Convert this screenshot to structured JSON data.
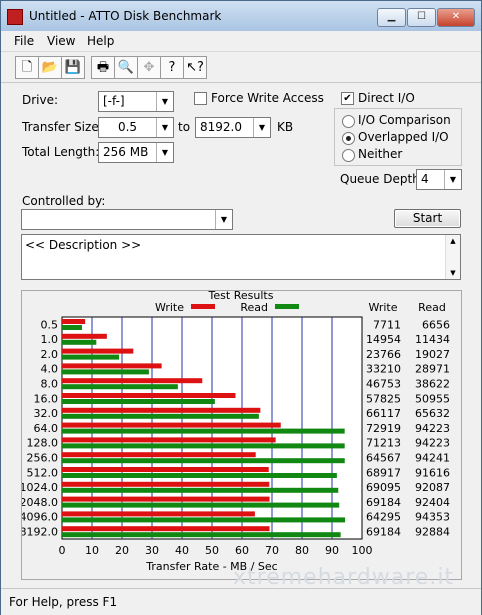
{
  "window": {
    "title": "Untitled - ATTO Disk Benchmark"
  },
  "title_buttons": {
    "minimize": "▁",
    "maximize": "☐",
    "close": "✕"
  },
  "menu": [
    "File",
    "View",
    "Help"
  ],
  "toolbar": [
    "new-icon",
    "open-icon",
    "save-icon",
    "print-icon",
    "print-preview-icon",
    "move-icon",
    "help-icon",
    "context-help-icon"
  ],
  "settings": {
    "drive_label": "Drive:",
    "drive_value": "[-f-]",
    "force_write_label": "Force Write Access",
    "force_write_checked": false,
    "direct_io_label": "Direct I/O",
    "direct_io_checked": true,
    "transfer_size_label": "Transfer Size:",
    "transfer_from": "0.5",
    "transfer_to_label": "to",
    "transfer_to": "8192.0",
    "transfer_unit": "KB",
    "total_length_label": "Total Length:",
    "total_length": "256 MB",
    "io_options": [
      "I/O Comparison",
      "Overlapped I/O",
      "Neither"
    ],
    "io_selected": "Overlapped I/O",
    "queue_depth_label": "Queue Depth:",
    "queue_depth": "4",
    "controlled_by_label": "Controlled by:",
    "controlled_by_value": "",
    "start_label": "Start",
    "description": "<< Description >>"
  },
  "results": {
    "title": "Test Results",
    "legend_write": "Write",
    "legend_read": "Read",
    "col_write": "Write",
    "col_read": "Read",
    "write_color": "#dd1111",
    "read_color": "#118811"
  },
  "chart_data": {
    "type": "bar",
    "xlabel": "Transfer Rate - MB / Sec",
    "xlim": [
      0,
      100
    ],
    "xticks": [
      "0",
      "10",
      "20",
      "30",
      "40",
      "50",
      "60",
      "70",
      "80",
      "90",
      "100"
    ],
    "categories": [
      "0.5",
      "1.0",
      "2.0",
      "4.0",
      "8.0",
      "16.0",
      "32.0",
      "64.0",
      "128.0",
      "256.0",
      "512.0",
      "1024.0",
      "2048.0",
      "4096.0",
      "8192.0"
    ],
    "series": [
      {
        "name": "Write",
        "values": [
          7.711,
          14.954,
          23.766,
          33.21,
          46.753,
          57.825,
          66.117,
          72.919,
          71.213,
          64.567,
          68.917,
          69.095,
          69.184,
          64.295,
          69.184
        ]
      },
      {
        "name": "Read",
        "values": [
          6.656,
          11.434,
          19.027,
          28.971,
          38.622,
          50.955,
          65.632,
          94.223,
          94.223,
          94.241,
          91.616,
          92.087,
          92.404,
          94.353,
          92.884
        ]
      }
    ],
    "write_labels": [
      "7711",
      "14954",
      "23766",
      "33210",
      "46753",
      "57825",
      "66117",
      "72919",
      "71213",
      "64567",
      "68917",
      "69095",
      "69184",
      "64295",
      "69184"
    ],
    "read_labels": [
      "6656",
      "11434",
      "19027",
      "28971",
      "38622",
      "50955",
      "65632",
      "94223",
      "94223",
      "94241",
      "91616",
      "92087",
      "92404",
      "94353",
      "92884"
    ]
  },
  "status": {
    "text": "For Help, press F1"
  },
  "watermark": "xtremehardware.it"
}
